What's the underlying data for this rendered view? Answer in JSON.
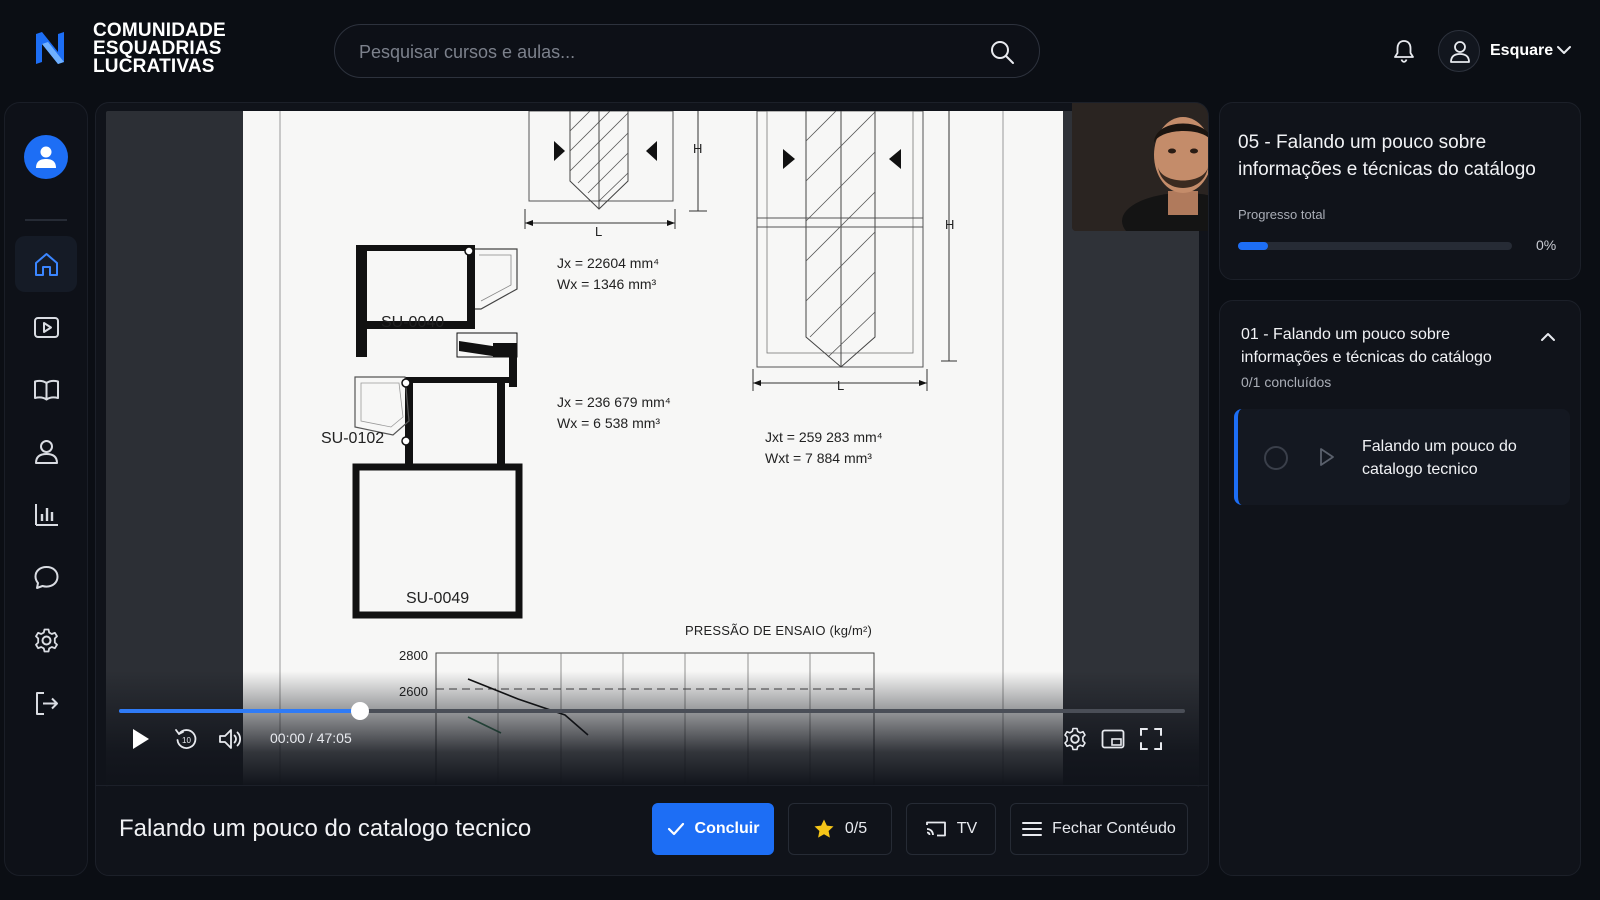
{
  "header": {
    "brand_lines": [
      "COMUNIDADE",
      "ESQUADRIAS",
      "LUCRATIVAS"
    ],
    "search_placeholder": "Pesquisar cursos e aulas...",
    "user_name": "Esquare"
  },
  "sidebar": {
    "items": [
      {
        "name": "home",
        "active": true
      },
      {
        "name": "videos",
        "active": false
      },
      {
        "name": "library",
        "active": false
      },
      {
        "name": "profile",
        "active": false
      },
      {
        "name": "stats",
        "active": false
      },
      {
        "name": "chat",
        "active": false
      },
      {
        "name": "settings",
        "active": false
      },
      {
        "name": "logout",
        "active": false
      }
    ]
  },
  "video": {
    "document": {
      "profile_1": "SU-0040",
      "profile_2": "SU-0102",
      "profile_3": "SU-0049",
      "jx_1": "Jx = 22604 mm⁴",
      "wx_1": "Wx = 1346 mm³",
      "jx_2": "Jx = 236 679 mm⁴",
      "wx_2": "Wx = 6 538 mm³",
      "jxt": "Jxt = 259 283 mm⁴",
      "wxt": "Wxt = 7 884 mm³",
      "dim_h": "H",
      "dim_l": "L",
      "chart_heading": "PRESSÃO DE ENSAIO (kg/m²)",
      "tick_2800": "2800",
      "tick_2600": "2600"
    },
    "current_time": "00:00",
    "duration": "47:05",
    "time_display": "00:00 / 47:05",
    "progress_fraction": 0.226
  },
  "lesson": {
    "title": "Falando um pouco do catalogo tecnico",
    "complete_label": "Concluir",
    "rating_label": "0/5",
    "tv_label": "TV",
    "close_content_label": "Fechar Contéudo"
  },
  "course": {
    "title": "05 - Falando um pouco sobre informações e técnicas do catálogo",
    "progress_label": "Progresso total",
    "progress_percent": "0%",
    "progress_fraction": 0.11
  },
  "module": {
    "title": "01 - Falando um pouco sobre informações e técnicas do catálogo",
    "count": "0/1 concluídos",
    "lessons": [
      {
        "name": "Falando um pouco do catalogo tecnico"
      }
    ]
  },
  "colors": {
    "accent": "#1d6ef5",
    "background": "#0b0e14",
    "card": "#10131a"
  }
}
